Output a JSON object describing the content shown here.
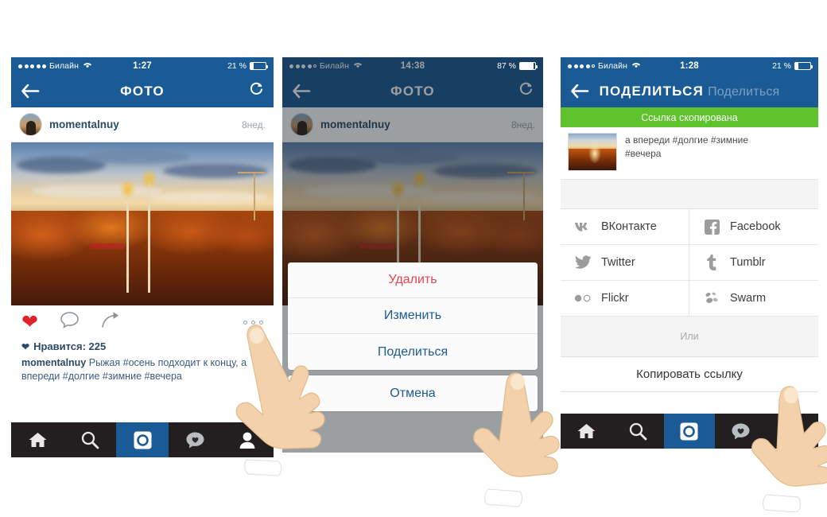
{
  "meta": {
    "description": "Three iPhone screenshots showing Instagram photo sharing flow in Russian",
    "accent_blue": "#1b5b95",
    "toast_green": "#5ec22c",
    "destructive_red": "#e6434f",
    "tabbar_dark": "#231f20",
    "heart_red": "#e0202a"
  },
  "phone1": {
    "status": {
      "carrier": "Билайн",
      "signal_dots_filled": 5,
      "wifi_icon": "wifi-icon",
      "time": "1:27",
      "battery_percent": "21 %",
      "battery_level": 21
    },
    "nav": {
      "back_icon": "arrow-left-icon",
      "title": "ФОТО",
      "refresh_icon": "refresh-icon"
    },
    "post": {
      "username": "momentalnuy",
      "age": "8нед.",
      "avatar_icon": "user-avatar",
      "photo_alt": "Autumn cityscape at sunset with orange trees"
    },
    "actions": {
      "like_icon": "heart-filled-icon",
      "comment_icon": "comment-bubble-icon",
      "share_icon": "share-arrow-icon",
      "more_icon": "more-dots-icon"
    },
    "likes_label": "Нравится: 225",
    "likes_count": 225,
    "caption": {
      "author": "momentalnuy",
      "text": " Рыжая #осень подходит к концу, а впереди #долгие #зимние #вечера"
    },
    "tabs": [
      {
        "name": "home-tab",
        "icon": "home-icon",
        "active": false
      },
      {
        "name": "search-tab",
        "icon": "search-icon",
        "active": false
      },
      {
        "name": "camera-tab",
        "icon": "camera-icon",
        "active": true
      },
      {
        "name": "activity-tab",
        "icon": "heart-bubble-icon",
        "active": false
      },
      {
        "name": "profile-tab",
        "icon": "person-icon",
        "active": false
      }
    ]
  },
  "phone2": {
    "status": {
      "carrier": "Билайн",
      "signal_dots_filled": 4,
      "wifi_icon": "wifi-icon",
      "time": "14:38",
      "battery_percent": "87 %",
      "battery_level": 87
    },
    "nav": {
      "back_icon": "arrow-left-icon",
      "title": "ФОТО",
      "refresh_icon": "refresh-icon"
    },
    "post": {
      "username": "momentalnuy",
      "age": "8нед."
    },
    "action_sheet": {
      "items": [
        {
          "label": "Удалить",
          "style": "destructive"
        },
        {
          "label": "Изменить",
          "style": "default"
        },
        {
          "label": "Поделиться",
          "style": "default"
        }
      ],
      "cancel": "Отмена"
    }
  },
  "phone3": {
    "status": {
      "carrier": "Билайн",
      "signal_dots_filled": 4,
      "wifi_icon": "wifi-icon",
      "time": "1:28",
      "battery_percent": "21 %",
      "battery_level": 21
    },
    "nav": {
      "back_icon": "arrow-left-icon",
      "title": "ПОДЕЛИТЬСЯ",
      "title_ghost": "Поделиться",
      "refresh_icon": "refresh-icon"
    },
    "toast": "Ссылка скопирована",
    "preview": {
      "caption_line1": "а впереди #долгие #зимние",
      "caption_line2": "#вечера"
    },
    "share_targets": [
      {
        "label": "ВКонтакте",
        "icon": "vk-icon"
      },
      {
        "label": "Facebook",
        "icon": "facebook-icon"
      },
      {
        "label": "Twitter",
        "icon": "twitter-icon"
      },
      {
        "label": "Tumblr",
        "icon": "tumblr-icon"
      },
      {
        "label": "Flickr",
        "icon": "flickr-icon"
      },
      {
        "label": "Swarm",
        "icon": "swarm-icon"
      }
    ],
    "or_label": "Или",
    "copy_link_label": "Копировать ссылку",
    "tabs": [
      {
        "name": "home-tab",
        "icon": "home-icon",
        "active": false
      },
      {
        "name": "search-tab",
        "icon": "search-icon",
        "active": false
      },
      {
        "name": "camera-tab",
        "icon": "camera-icon",
        "active": true
      },
      {
        "name": "activity-tab",
        "icon": "heart-bubble-icon",
        "active": false
      },
      {
        "name": "profile-tab",
        "icon": "person-icon",
        "active": false
      }
    ]
  },
  "cursors": [
    {
      "name": "pointing-hand-1",
      "target": "more-dots-icon"
    },
    {
      "name": "pointing-hand-2",
      "target": "share-sheet-item"
    },
    {
      "name": "pointing-hand-3",
      "target": "copy-link-row"
    }
  ]
}
